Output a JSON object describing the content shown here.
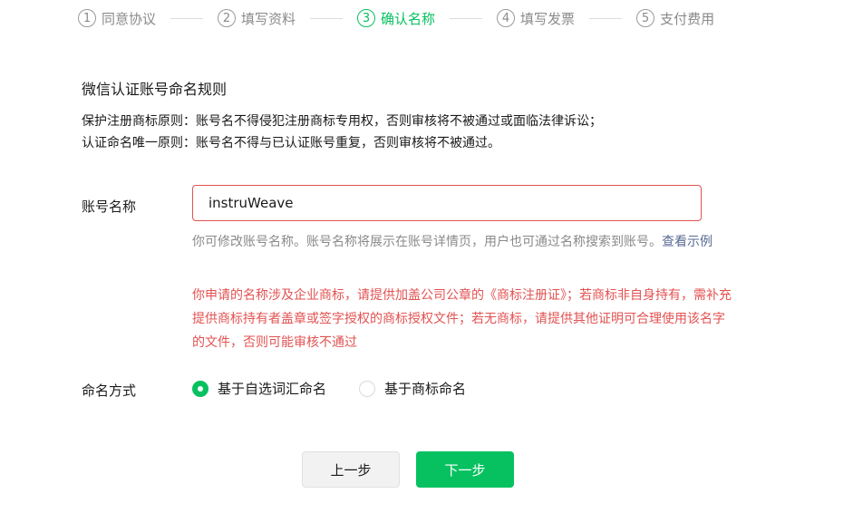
{
  "steps": [
    {
      "num": "1",
      "label": "同意协议",
      "active": false
    },
    {
      "num": "2",
      "label": "填写资料",
      "active": false
    },
    {
      "num": "3",
      "label": "确认名称",
      "active": true
    },
    {
      "num": "4",
      "label": "填写发票",
      "active": false
    },
    {
      "num": "5",
      "label": "支付费用",
      "active": false
    }
  ],
  "rules": {
    "title": "微信认证账号命名规则",
    "lines": [
      "保护注册商标原则：账号名不得侵犯注册商标专用权，否则审核将不被通过或面临法律诉讼；",
      "认证命名唯一原则：账号名不得与已认证账号重复，否则审核将不被通过。"
    ]
  },
  "account_name": {
    "label": "账号名称",
    "value": "instruWeave",
    "hint": "你可修改账号名称。账号名称将展示在账号详情页，用户也可通过名称搜索到账号。",
    "hint_link": "查看示例",
    "error": "你申请的名称涉及企业商标，请提供加盖公司公章的《商标注册证》；若商标非自身持有，需补充提供商标持有者盖章或签字授权的商标授权文件；若无商标，请提供其他证明可合理使用该名字的文件，否则可能审核不通过"
  },
  "naming_method": {
    "label": "命名方式",
    "options": [
      {
        "label": "基于自选词汇命名",
        "checked": true
      },
      {
        "label": "基于商标命名",
        "checked": false
      }
    ]
  },
  "buttons": {
    "prev": "上一步",
    "next": "下一步"
  },
  "colors": {
    "accent": "#07c160",
    "error": "#e35252",
    "link": "#576b95"
  }
}
